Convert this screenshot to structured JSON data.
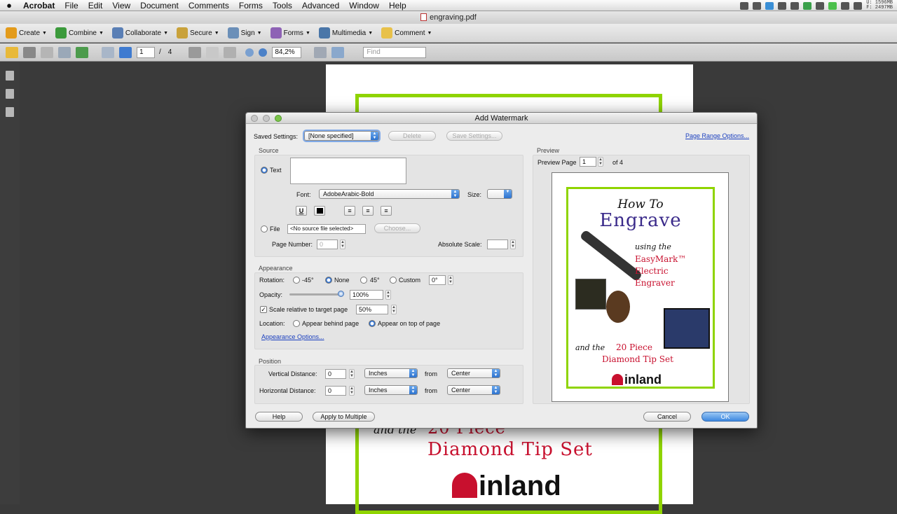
{
  "menubar": {
    "apple": "",
    "items": [
      "Acrobat",
      "File",
      "Edit",
      "View",
      "Document",
      "Comments",
      "Forms",
      "Tools",
      "Advanced",
      "Window",
      "Help"
    ],
    "memory_u": "U: 1596MB",
    "memory_f": "F: 2497MB"
  },
  "window": {
    "title": "engraving.pdf"
  },
  "toolbar1": [
    {
      "label": "Create",
      "icon": "create-icon",
      "color": "#e39b1b"
    },
    {
      "label": "Combine",
      "icon": "combine-icon",
      "color": "#3b9a3b"
    },
    {
      "label": "Collaborate",
      "icon": "collaborate-icon",
      "color": "#5a7fb5"
    },
    {
      "label": "Secure",
      "icon": "lock-icon",
      "color": "#c9a23b"
    },
    {
      "label": "Sign",
      "icon": "pen-icon",
      "color": "#6b8fb8"
    },
    {
      "label": "Forms",
      "icon": "forms-icon",
      "color": "#8e62b5"
    },
    {
      "label": "Multimedia",
      "icon": "multimedia-icon",
      "color": "#4a76a8"
    },
    {
      "label": "Comment",
      "icon": "comment-icon",
      "color": "#e8c14a"
    }
  ],
  "toolbar2": {
    "page_current": "1",
    "page_sep": "/",
    "page_total": "4",
    "zoom": "84,2%",
    "find_placeholder": "Find"
  },
  "page": {
    "line0": "and the",
    "line1": "20 Piece",
    "line2": "Diamond Tip Set",
    "logo": "inland"
  },
  "dialog": {
    "title": "Add Watermark",
    "saved_settings_label": "Saved Settings:",
    "saved_settings_value": "[None specified]",
    "delete_label": "Delete",
    "save_settings_label": "Save Settings...",
    "page_range_label": "Page Range Options...",
    "source": {
      "heading": "Source",
      "text_label": "Text",
      "text_value": "",
      "font_label": "Font:",
      "font_value": "AdobeArabic-Bold",
      "size_label": "Size:",
      "size_value": "",
      "underline_label": "U",
      "file_label": "File",
      "file_value": "<No source file selected>",
      "choose_label": "Choose...",
      "page_number_label": "Page Number:",
      "page_number_value": "0",
      "absolute_scale_label": "Absolute Scale:",
      "absolute_scale_value": ""
    },
    "appearance": {
      "heading": "Appearance",
      "rotation_label": "Rotation:",
      "rot_neg45": "-45°",
      "rot_none": "None",
      "rot_45": "45°",
      "rot_custom": "Custom",
      "custom_value": "0°",
      "opacity_label": "Opacity:",
      "opacity_value": "100%",
      "scale_label": "Scale relative to target page",
      "scale_value": "50%",
      "location_label": "Location:",
      "loc_behind": "Appear behind page",
      "loc_top": "Appear on top of page",
      "options_link": "Appearance Options..."
    },
    "position": {
      "heading": "Position",
      "vertical_label": "Vertical Distance:",
      "vertical_value": "0",
      "vertical_unit": "Inches",
      "vertical_from_label": "from",
      "vertical_from": "Center",
      "horizontal_label": "Horizontal Distance:",
      "horizontal_value": "0",
      "horizontal_unit": "Inches",
      "horizontal_from_label": "from",
      "horizontal_from": "Center"
    },
    "preview": {
      "heading": "Preview",
      "page_label": "Preview Page",
      "page_value": "1",
      "page_of": "of 4",
      "t1": "How To",
      "t2": "Engrave",
      "t3": "using the",
      "t4a": "EasyMark™",
      "t4b": "Electric",
      "t4c": "Engraver",
      "t5": "and the",
      "t6a": "20 Piece",
      "t6b": "Diamond Tip Set",
      "logo": "inland"
    },
    "help_label": "Help",
    "apply_multiple_label": "Apply to Multiple",
    "cancel_label": "Cancel",
    "ok_label": "OK"
  }
}
